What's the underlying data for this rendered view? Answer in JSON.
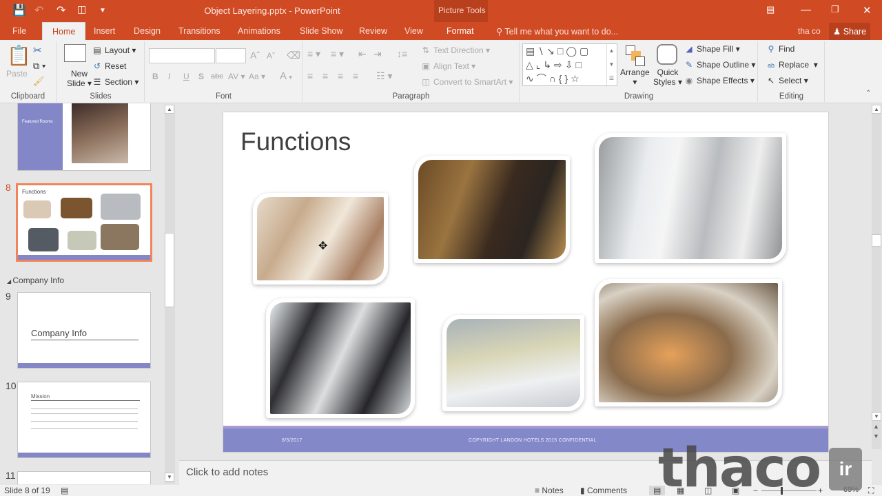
{
  "window": {
    "title": "Object Layering.pptx - PowerPoint",
    "context_group": "Picture Tools",
    "controls": [
      "ribbon-display-options",
      "minimize",
      "restore",
      "close"
    ]
  },
  "qat": {
    "save": "save-icon",
    "undo": "undo-icon",
    "redo": "redo-icon",
    "present": "present-from-start-icon",
    "customize": "customize-qat-icon"
  },
  "tabs": [
    "File",
    "Home",
    "Insert",
    "Design",
    "Transitions",
    "Animations",
    "Slide Show",
    "Review",
    "View",
    "Format"
  ],
  "active_tab": "Home",
  "tell_me": "Tell me what you want to do...",
  "user": "tha co",
  "share": "Share",
  "ribbon": {
    "clipboard": {
      "label": "Clipboard",
      "paste": "Paste"
    },
    "slides": {
      "label": "Slides",
      "new_slide_1": "New",
      "new_slide_2": "Slide",
      "layout": "Layout",
      "reset": "Reset",
      "section": "Section"
    },
    "font": {
      "label": "Font",
      "font_name": "",
      "font_size": "",
      "bold": "B",
      "italic": "I",
      "underline": "U",
      "shadow": "S",
      "strike": "abc",
      "spacing": "AV",
      "case": "Aa",
      "color": "A"
    },
    "paragraph": {
      "label": "Paragraph",
      "text_direction": "Text Direction",
      "align_text": "Align Text",
      "convert_smartart": "Convert to SmartArt"
    },
    "drawing": {
      "label": "Drawing",
      "arrange": "Arrange",
      "quick_styles_1": "Quick",
      "quick_styles_2": "Styles",
      "shape_fill": "Shape Fill",
      "shape_outline": "Shape Outline",
      "shape_effects": "Shape Effects"
    },
    "editing": {
      "label": "Editing",
      "find": "Find",
      "replace": "Replace",
      "select": "Select"
    }
  },
  "thumbnails": [
    {
      "number": "",
      "title": "Featured Rooms"
    },
    {
      "number": "8",
      "title": "Functions",
      "selected": true
    },
    {
      "section": "Company Info"
    },
    {
      "number": "9",
      "title": "Company Info"
    },
    {
      "number": "10",
      "title": "Mission"
    },
    {
      "number": "11",
      "title": ""
    }
  ],
  "slide": {
    "title": "Functions",
    "footer_date": "8/5/2017",
    "footer_text": "COPYRIGHT LANDON HOTELS 2015 CONFIDENTIAL",
    "pictures": [
      "bridal-party-photo",
      "hotel-check-in-photo",
      "chef-team-photo",
      "business-lunch-photo",
      "banquet-hall-photo",
      "buffet-display-photo"
    ]
  },
  "notes_placeholder": "Click to add notes",
  "status": {
    "slide_indicator": "Slide 8 of 19",
    "notes": "Notes",
    "comments": "Comments",
    "zoom_level": "69%",
    "zoom_fraction": 0.69
  },
  "watermark": {
    "text": "thaco",
    "badge": "ir"
  }
}
